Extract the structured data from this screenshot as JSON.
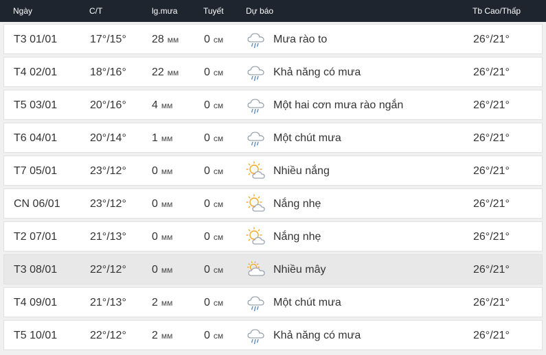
{
  "header": {
    "day": "Ngày",
    "temp": "C/T",
    "rain": "lg.mưa",
    "snow": "Tuyết",
    "forecast": "Dự báo",
    "avg": "Tb Cao/Thấp"
  },
  "rows": [
    {
      "day": "T3 01/01",
      "temp": "17°/15°",
      "rain": "28",
      "rain_unit": "мм",
      "snow": "0",
      "snow_unit": "см",
      "icon": "rain-cloud-icon",
      "forecast": "Mưa rào to",
      "avg": "26°/21°"
    },
    {
      "day": "T4 02/01",
      "temp": "18°/16°",
      "rain": "22",
      "rain_unit": "мм",
      "snow": "0",
      "snow_unit": "см",
      "icon": "rain-cloud-icon",
      "forecast": "Khả năng có mưa",
      "avg": "26°/21°"
    },
    {
      "day": "T5 03/01",
      "temp": "20°/16°",
      "rain": "4",
      "rain_unit": "мм",
      "snow": "0",
      "snow_unit": "см",
      "icon": "rain-cloud-icon",
      "forecast": "Một hai cơn mưa rào ngắn",
      "avg": "26°/21°"
    },
    {
      "day": "T6 04/01",
      "temp": "20°/14°",
      "rain": "1",
      "rain_unit": "мм",
      "snow": "0",
      "snow_unit": "см",
      "icon": "rain-cloud-icon",
      "forecast": "Một chút mưa",
      "avg": "26°/21°"
    },
    {
      "day": "T7 05/01",
      "temp": "23°/12°",
      "rain": "0",
      "rain_unit": "мм",
      "snow": "0",
      "snow_unit": "см",
      "icon": "sun-cloud-icon",
      "forecast": "Nhiều nắng",
      "avg": "26°/21°"
    },
    {
      "day": "CN 06/01",
      "temp": "23°/12°",
      "rain": "0",
      "rain_unit": "мм",
      "snow": "0",
      "snow_unit": "см",
      "icon": "sun-cloud-icon",
      "forecast": "Nắng nhẹ",
      "avg": "26°/21°"
    },
    {
      "day": "T2 07/01",
      "temp": "21°/13°",
      "rain": "0",
      "rain_unit": "мм",
      "snow": "0",
      "snow_unit": "см",
      "icon": "sun-cloud-icon",
      "forecast": "Nắng nhẹ",
      "avg": "26°/21°"
    },
    {
      "day": "T3 08/01",
      "temp": "22°/12°",
      "rain": "0",
      "rain_unit": "мм",
      "snow": "0",
      "snow_unit": "см",
      "icon": "cloudy-sun-icon",
      "forecast": "Nhiều mây",
      "avg": "26°/21°"
    },
    {
      "day": "T4 09/01",
      "temp": "21°/13°",
      "rain": "2",
      "rain_unit": "мм",
      "snow": "0",
      "snow_unit": "см",
      "icon": "rain-cloud-icon",
      "forecast": "Một chút mưa",
      "avg": "26°/21°"
    },
    {
      "day": "T5 10/01",
      "temp": "22°/12°",
      "rain": "2",
      "rain_unit": "мм",
      "snow": "0",
      "snow_unit": "см",
      "icon": "rain-cloud-icon",
      "forecast": "Khả năng có mưa",
      "avg": "26°/21°"
    }
  ],
  "highlighted_row": 7,
  "colors": {
    "header_bg": "#1e252f",
    "row_bg": "#ffffff",
    "highlight_bg": "#e8e8e8",
    "sun": "#f5a623",
    "cloud": "#9aa4ad",
    "rain": "#5a8fc0"
  }
}
